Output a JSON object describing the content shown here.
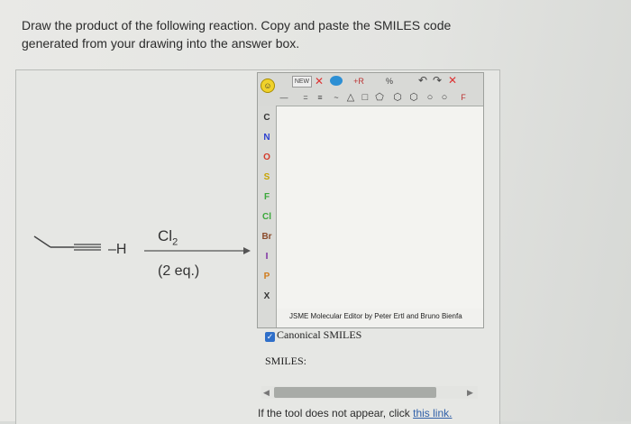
{
  "question": {
    "text": "Draw the product of the following reaction. Copy and paste the SMILES code generated from your drawing into the answer box."
  },
  "reaction": {
    "hydrogen_label": "–H",
    "reagent_main": "Cl",
    "reagent_sub": "2",
    "conditions": "(2 eq.)"
  },
  "jsme": {
    "toolbar_new": "NEW",
    "toolbar_r": "+R",
    "toolbar_pct": "%",
    "toolbar_f": "F",
    "elements": [
      "C",
      "N",
      "O",
      "S",
      "F",
      "Cl",
      "Br",
      "I",
      "P",
      "X"
    ],
    "element_colors": [
      "#333333",
      "#2b3fd0",
      "#d43a2a",
      "#c8a400",
      "#3aa83a",
      "#3aa83a",
      "#8a4a2a",
      "#7a2aa0",
      "#d07a1a",
      "#333333"
    ],
    "credit": "JSME Molecular Editor by Peter Ertl and Bruno Bienfa",
    "canonical_label": "Canonical SMILES",
    "canonical_checked": true,
    "smiles_label": "SMILES:"
  },
  "footer": {
    "prefix": "If the tool does not appear, click ",
    "link_text": "this link."
  }
}
